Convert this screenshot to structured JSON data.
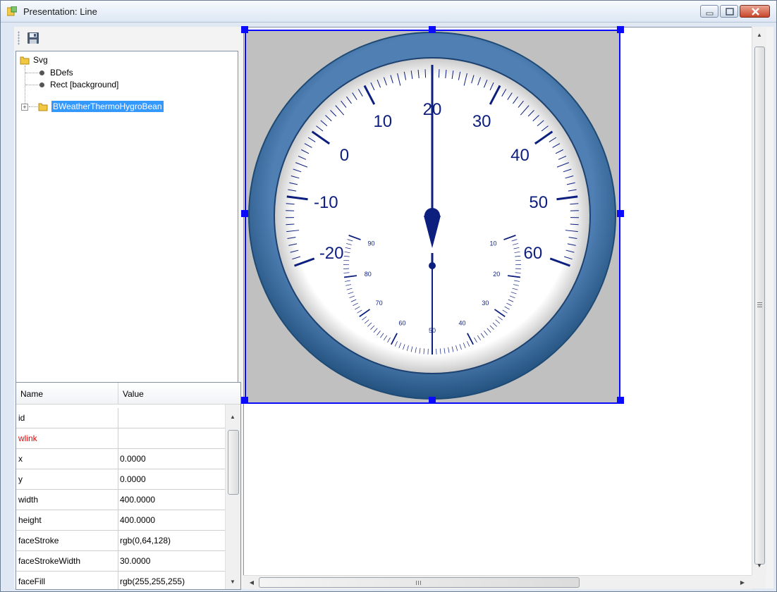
{
  "window": {
    "title": "Presentation: Line"
  },
  "toolbar": {
    "save_icon": "floppy-disk-icon"
  },
  "tree": {
    "root": "Svg",
    "items": [
      {
        "label": "BDefs",
        "type": "leaf"
      },
      {
        "label": "Rect [background]",
        "type": "leaf"
      },
      {
        "label": "BWeatherThermoHygroBean",
        "type": "folder",
        "selected": true,
        "collapsed": true
      }
    ]
  },
  "properties": {
    "headers": {
      "name": "Name",
      "value": "Value"
    },
    "rows": [
      {
        "name": "id",
        "value": ""
      },
      {
        "name": "wlink",
        "value": ""
      },
      {
        "name": "x",
        "value": "0.0000"
      },
      {
        "name": "y",
        "value": "0.0000"
      },
      {
        "name": "width",
        "value": "400.0000"
      },
      {
        "name": "height",
        "value": "400.0000"
      },
      {
        "name": "faceStroke",
        "value": "rgb(0,64,128)"
      },
      {
        "name": "faceStrokeWidth",
        "value": "30.0000"
      },
      {
        "name": "faceFill",
        "value": "rgb(255,255,255)"
      }
    ]
  },
  "gauge": {
    "main_scale": [
      "-20",
      "-10",
      "0",
      "10",
      "20",
      "30",
      "40",
      "50",
      "60"
    ],
    "main_value": 20,
    "sub_scale": [
      "10",
      "20",
      "30",
      "40",
      "50",
      "60",
      "70",
      "80",
      "90"
    ],
    "sub_value": 50,
    "colors": {
      "ring": "#3a6a9e",
      "ink": "#0c1e7e",
      "background": "#c0c0c0",
      "selection": "#0a0aff"
    }
  }
}
